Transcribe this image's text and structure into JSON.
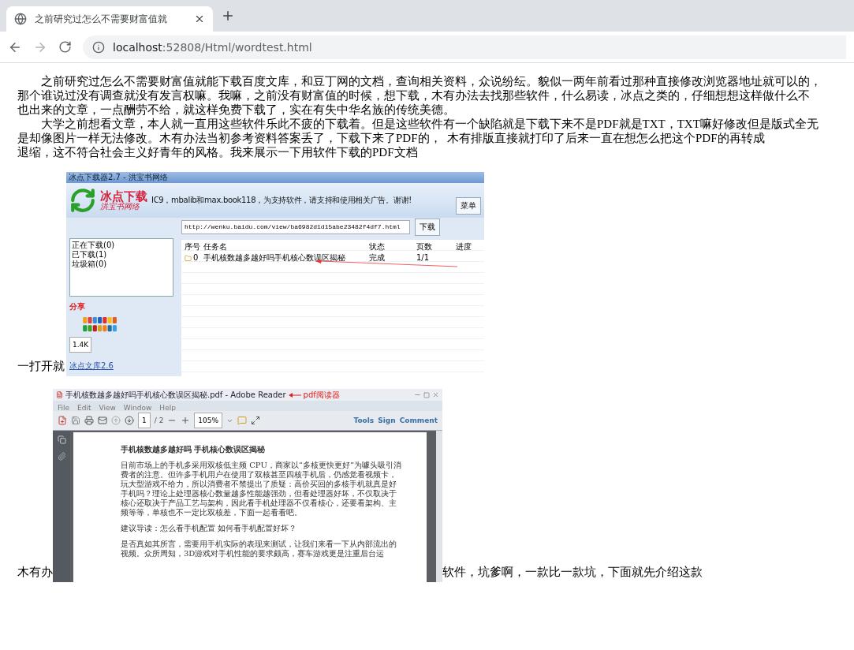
{
  "browser": {
    "tab": {
      "title": "之前研究过怎么不需要财富值就",
      "selected": true
    },
    "back": {
      "disabled": false
    },
    "forward": {
      "disabled": true
    },
    "address": {
      "host": "localhost",
      "path": ":52808/Html/wordtest.html"
    }
  },
  "article": {
    "lines": [
      {
        "kind": "start",
        "text": "之前研究过怎么不需要财富值就能下载百度文库，和豆丁网的文档，查询相关资料，众说纷纭。貌似一两年前看过那种直接修改浏览器地址就可以的，"
      },
      {
        "kind": "continue",
        "text": "那个谁说过没有调查就没有发言权嘛。我嘛，之前没有财富值的时候，想下载，木有办法去找那些软件，什么易读，冰点之类的，仔细想想这样做什么不"
      },
      {
        "kind": "continue",
        "text": "也出来的文章，一点酬劳不给，就这样免费下载了，实在有失中华名族的传统美德。"
      },
      {
        "kind": "start",
        "text": "大学之前想看文章，本人就一直用这些软件乐此不疲的下载着。但是这些软件有一个缺陷就是下载下来不是PDF就是TXT，TXT嘛好修改但是版式全无"
      },
      {
        "kind": "continue",
        "text": "是却像图片一样无法修改。木有办法当初参考资料答案丢了，下载下来了PDF的，  木有排版直接就打印了后来一直在想怎么把这个PDF的再转成"
      },
      {
        "kind": "continue",
        "text": "退缩，这不符合社会主义好青年的风格。我来展示一下用软件下载的PDF文档"
      }
    ]
  },
  "figures": [
    {
      "kind": "downloader",
      "text_before": "一打开就",
      "title": "冰点下载器2.7 - 洪宝书网络",
      "brand": "冰点下载",
      "brand_sub": "洪宝书网络",
      "notice": "IC9，mbalib和max.book118，为支持软件，请支持和使用相关广告。谢谢!",
      "menu_button": "菜单",
      "url": "http://wenku.baidu.com/view/ba6982d1d15abe23482f4df7.html",
      "download_button": "下载",
      "sidebar_items": [
        {
          "label": "正在下载(0)",
          "selected": false
        },
        {
          "label": "已下载(1)",
          "selected": false
        },
        {
          "label": "垃圾箱(0)",
          "selected": false
        }
      ],
      "columns": [
        "序号",
        "任务名",
        "状态",
        "页数",
        "进度"
      ],
      "rows": [
        [
          "0",
          "手机核数越多越好吗手机核心数误区揭秘",
          "完成",
          "1/1",
          ""
        ]
      ],
      "share_heading": "分享",
      "share_count": "1.4K",
      "links": [
        "冰点文库2.6"
      ]
    },
    {
      "kind": "reader",
      "text_before": "木有办",
      "text_after": "软件，坑爹啊，一款比一款坑，下面就先介绍这款",
      "title": "手机核数越多越好吗手机核心数误区揭秘.pdf - Adobe Reader",
      "annotation": "pdf阅读器",
      "menu": [
        "File",
        "Edit",
        "View",
        "Window",
        "Help"
      ],
      "page": "1",
      "page_total": "/ 2",
      "zoom": "105%",
      "tools": [
        "Tools",
        "Sign",
        "Comment"
      ],
      "doc": {
        "heading": "手机核数越多越好吗  手机核心数误区揭秘",
        "paragraphs": [
          "目前市场上的手机多采用双核低主频 CPU，商家以“多核更快更好”为噱头吸引消费者的注意。但许多手机用户在使用了双核甚至四核手机后，仍感觉看视频卡，玩大型游戏不给力，所以消费者不禁提出了质疑：高价买回的多核手机就真是好手机吗？理论上处理器核心数量越多性能越强劲，但看处理器好坏，不仅取决于核心还取决于产品工艺与架构，因此看手机处理器不仅看核心，还要看架构、主频等等，单核也不一定比双核差，下面一起看看吧。",
          "建议导读：怎么看手机配置 如何看手机配置好坏？",
          "是否真如其所言，需要用手机实际的表现来测试，让我们来看一下从内部流出的视频。众所周知，3D游戏对手机性能的要求颇高，赛车游戏更是注重后台运"
        ]
      }
    }
  ]
}
